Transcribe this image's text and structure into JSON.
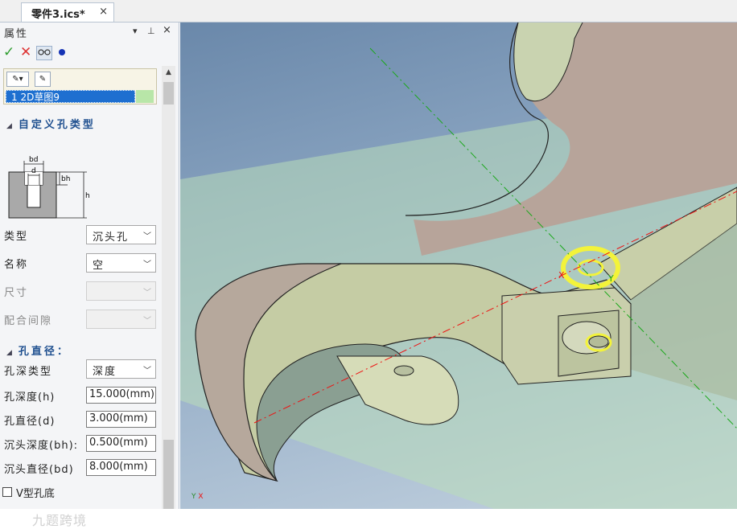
{
  "tab": {
    "label": "零件3.ics*",
    "close": "×"
  },
  "panel": {
    "title": "属性",
    "header_buttons": [
      "▾",
      "⊥",
      "×"
    ],
    "actions": {
      "ok": "✓",
      "cancel": "✕"
    },
    "selection": {
      "item": "1 2D草图9"
    },
    "section_custom_hole": "自定义孔类型",
    "section_hole_diameter": "孔直径：",
    "fields": {
      "type": {
        "label": "类型",
        "value": "沉头孔"
      },
      "name": {
        "label": "名称",
        "value": "空"
      },
      "size": {
        "label": "尺寸",
        "value": ""
      },
      "fit": {
        "label": "配合间隙",
        "value": ""
      },
      "depth_type": {
        "label": "孔深类型",
        "value": "深度"
      },
      "hole_depth": {
        "label": "孔深度(h)",
        "value": "15.000(mm)"
      },
      "hole_diameter": {
        "label": "孔直径(d)",
        "value": "3.000(mm)"
      },
      "cb_depth": {
        "label": "沉头深度(bh):",
        "value": "0.500(mm)"
      },
      "cb_diameter": {
        "label": "沉头直径(bd)",
        "value": "8.000(mm)"
      }
    },
    "vhole_label": "V型孔底",
    "diagram_labels": {
      "bd": "bd",
      "d": "d",
      "bh": "bh",
      "h": "h"
    }
  },
  "viewport": {
    "triad_x": "X",
    "triad_y": "Y"
  },
  "watermark": "九题跨境",
  "colors": {
    "selection": "#1e6fd0",
    "section_text": "#1e4f8f",
    "highlight": "#f3f33a"
  }
}
